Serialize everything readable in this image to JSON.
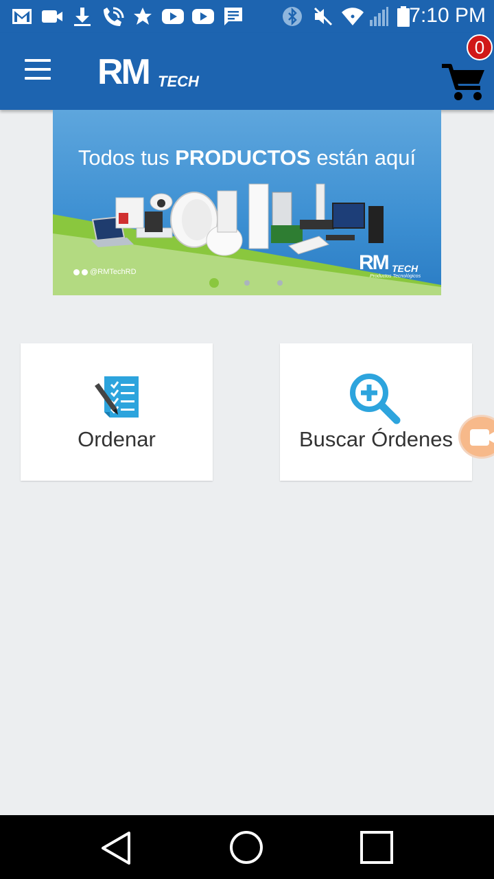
{
  "status_bar": {
    "time": "7:10 PM",
    "icons": [
      "gmail-icon",
      "video-call-icon",
      "download-icon",
      "wifi-call-icon",
      "star-icon",
      "youtube-icon",
      "youtube-icon",
      "message-icon",
      "bluetooth-icon",
      "mute-icon",
      "wifi-icon",
      "signal-icon",
      "battery-icon"
    ]
  },
  "app_bar": {
    "logo_text": "RM",
    "logo_sub": "TECH",
    "cart_count": "0",
    "colors": {
      "primary": "#1d64b0",
      "badge": "#d01818"
    }
  },
  "banner": {
    "headline_pre": "Todos tus ",
    "headline_bold": "PRODUCTOS",
    "headline_post": " están aquí",
    "social_handle": "@RMTechRD",
    "logo_text": "RM",
    "logo_sub": "TECH",
    "logo_tagline": "Productos Tecnológicos",
    "slides": 3,
    "active_slide": 1,
    "colors": {
      "sky": "#3c8fd2",
      "green": "#8ac73e"
    }
  },
  "actions": [
    {
      "label": "Ordenar",
      "icon": "checklist-pen-icon"
    },
    {
      "label": "Buscar Órdenes",
      "icon": "zoom-in-search-icon"
    }
  ],
  "nav_bar": {
    "icons": [
      "back-icon",
      "home-icon",
      "recents-icon"
    ]
  }
}
